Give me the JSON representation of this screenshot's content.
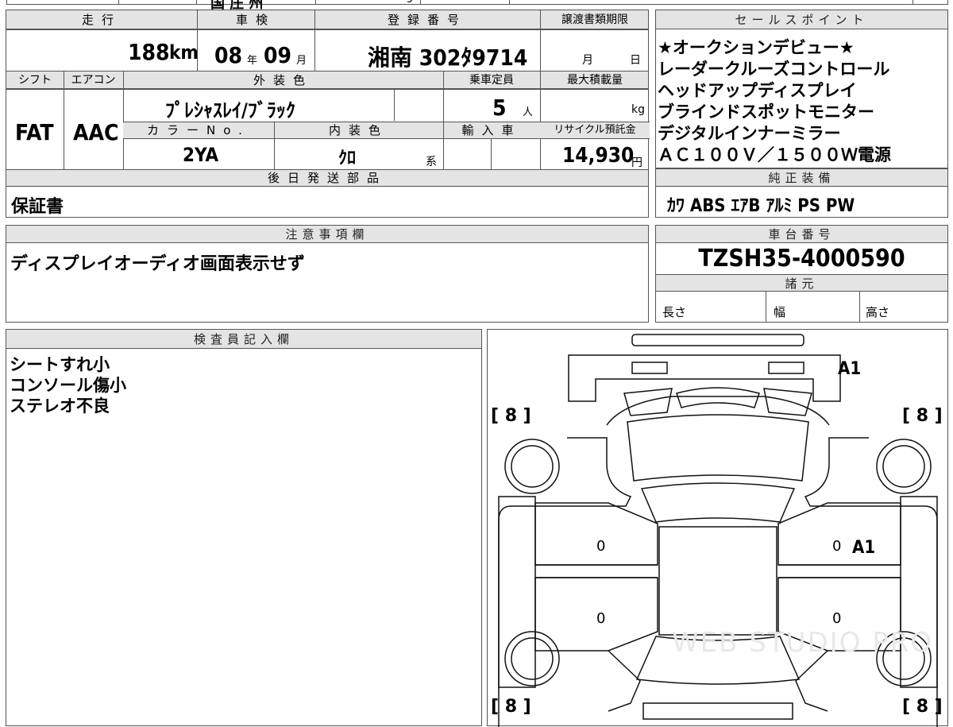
{
  "top_strip": {
    "fragment_a": "国 庄 州",
    "fragment_b": "ɔ"
  },
  "main_table": {
    "mileage_label": "走行",
    "mileage_value": "188",
    "mileage_unit": "km",
    "inspection_label": "車検",
    "inspection_year": "08",
    "inspection_year_unit": "年",
    "inspection_month": "09",
    "inspection_month_unit": "月",
    "plate_label": "登録番号",
    "plate_value": "湘南 302ﾀ9714",
    "transfer_label": "譲渡書類期限",
    "transfer_month_unit": "月",
    "transfer_day_unit": "日",
    "shift_label": "シフト",
    "shift_value": "FAT",
    "ac_label": "エアコン",
    "ac_value": "AAC",
    "exterior_label": "外装色",
    "exterior_value": "ﾌﾟﾚｼｬｽﾚｲ/ﾌﾞﾗｯｸ",
    "capacity_label": "乗車定員",
    "capacity_value": "5",
    "capacity_unit": "人",
    "load_label": "最大積載量",
    "load_unit": "kg",
    "color_no_label": "カラーNo.",
    "color_no_value": "2YA",
    "interior_label": "内装色",
    "interior_value": "ｸﾛ",
    "interior_suffix": "系",
    "import_label": "輸入車",
    "recycle_label": "リサイクル預託金",
    "recycle_value": "14,930",
    "recycle_unit": "円",
    "later_parts_label": "後日発送部品",
    "later_parts_value": "保証書"
  },
  "sales_points": {
    "label": "セールスポイント",
    "lines": [
      "★オークションデビュー★",
      "レーダークルーズコントロール",
      "ヘッドアップディスプレイ",
      "ブラインドスポットモニター",
      "デジタルインナーミラー",
      "ＡＣ１００Ｖ／１５００Ｗ電源"
    ]
  },
  "genuine_equipment": {
    "label": "純正装備",
    "value": "ｶﾜ ABS ｴｱB ｱﾙﾐ PS PW"
  },
  "notes": {
    "label": "注意事項欄",
    "value": "ディスプレイオーディオ画面表示せず"
  },
  "chassis": {
    "label": "車台番号",
    "value": "TZSH35-4000590"
  },
  "specs": {
    "label": "諸元",
    "length_label": "長さ",
    "width_label": "幅",
    "height_label": "高さ"
  },
  "inspector": {
    "label": "検査員記入欄",
    "lines": [
      "シートすれ小",
      "コンソール傷小",
      "ステレオ不良"
    ]
  },
  "diagram": {
    "tire_fl": "[ 8 ]",
    "tire_fr": "[ 8 ]",
    "tire_rl": "[ 8 ]",
    "tire_rr": "[ 8 ]",
    "mark_front": "A1",
    "mark_right": "A1",
    "door_lf": "0",
    "door_rf": "0",
    "door_lr": "0",
    "door_rr": "0",
    "watermark": "WEB STUDIO PRO"
  },
  "colors": {
    "header_bg": "#e4e4e4",
    "border": "#555555"
  }
}
